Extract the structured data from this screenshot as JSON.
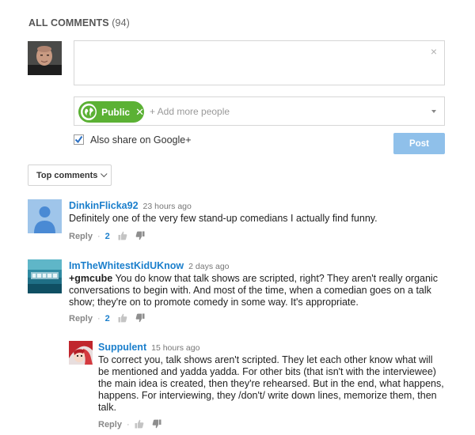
{
  "heading": {
    "title": "ALL COMMENTS",
    "count": "(94)"
  },
  "compose": {
    "close_glyph": "×"
  },
  "share": {
    "chip_label": "Public",
    "chip_remove_glyph": "✕",
    "add_people_placeholder": "+ Add more people",
    "google_plus_label": "Also share on Google+",
    "google_plus_checked": true,
    "post_label": "Post"
  },
  "sort": {
    "label": "Top comments"
  },
  "colors": {
    "link": "#1b7fcc",
    "public_chip": "#5bb134",
    "post_button": "#8fc0ea"
  },
  "comments": [
    {
      "author": "DinkinFlicka92",
      "time": "23 hours ago",
      "text": "Definitely one of the very few stand-up comedians I actually find funny.",
      "reply_label": "Reply",
      "separator": "·",
      "likes": "2",
      "avatar_icon": "default-person-icon"
    },
    {
      "author": "ImTheWhitestKidUKnow",
      "time": "2 days ago",
      "mention": "+gmcube",
      "text": " You do know that talk shows are scripted, right? They aren't really organic conversations to begin with. And most of the time, when a comedian goes on a talk show; they're on to promote comedy in some way. It's appropriate.",
      "reply_label": "Reply",
      "separator": "·",
      "likes": "2",
      "avatar_icon": "ocean-photo-avatar"
    },
    {
      "author": "Suppulent",
      "time": "15 hours ago",
      "text": "To correct you, talk shows aren't scripted. They let each other know what will be mentioned and yadda yadda. For other bits (that isn't with the interviewee) the main idea is created, then they're rehearsed. But in the end, what happens, happens. For interviewing, they /don't/ write down lines, memorize them, then talk.",
      "reply_label": "Reply",
      "separator": "·",
      "avatar_icon": "anime-avatar"
    }
  ]
}
